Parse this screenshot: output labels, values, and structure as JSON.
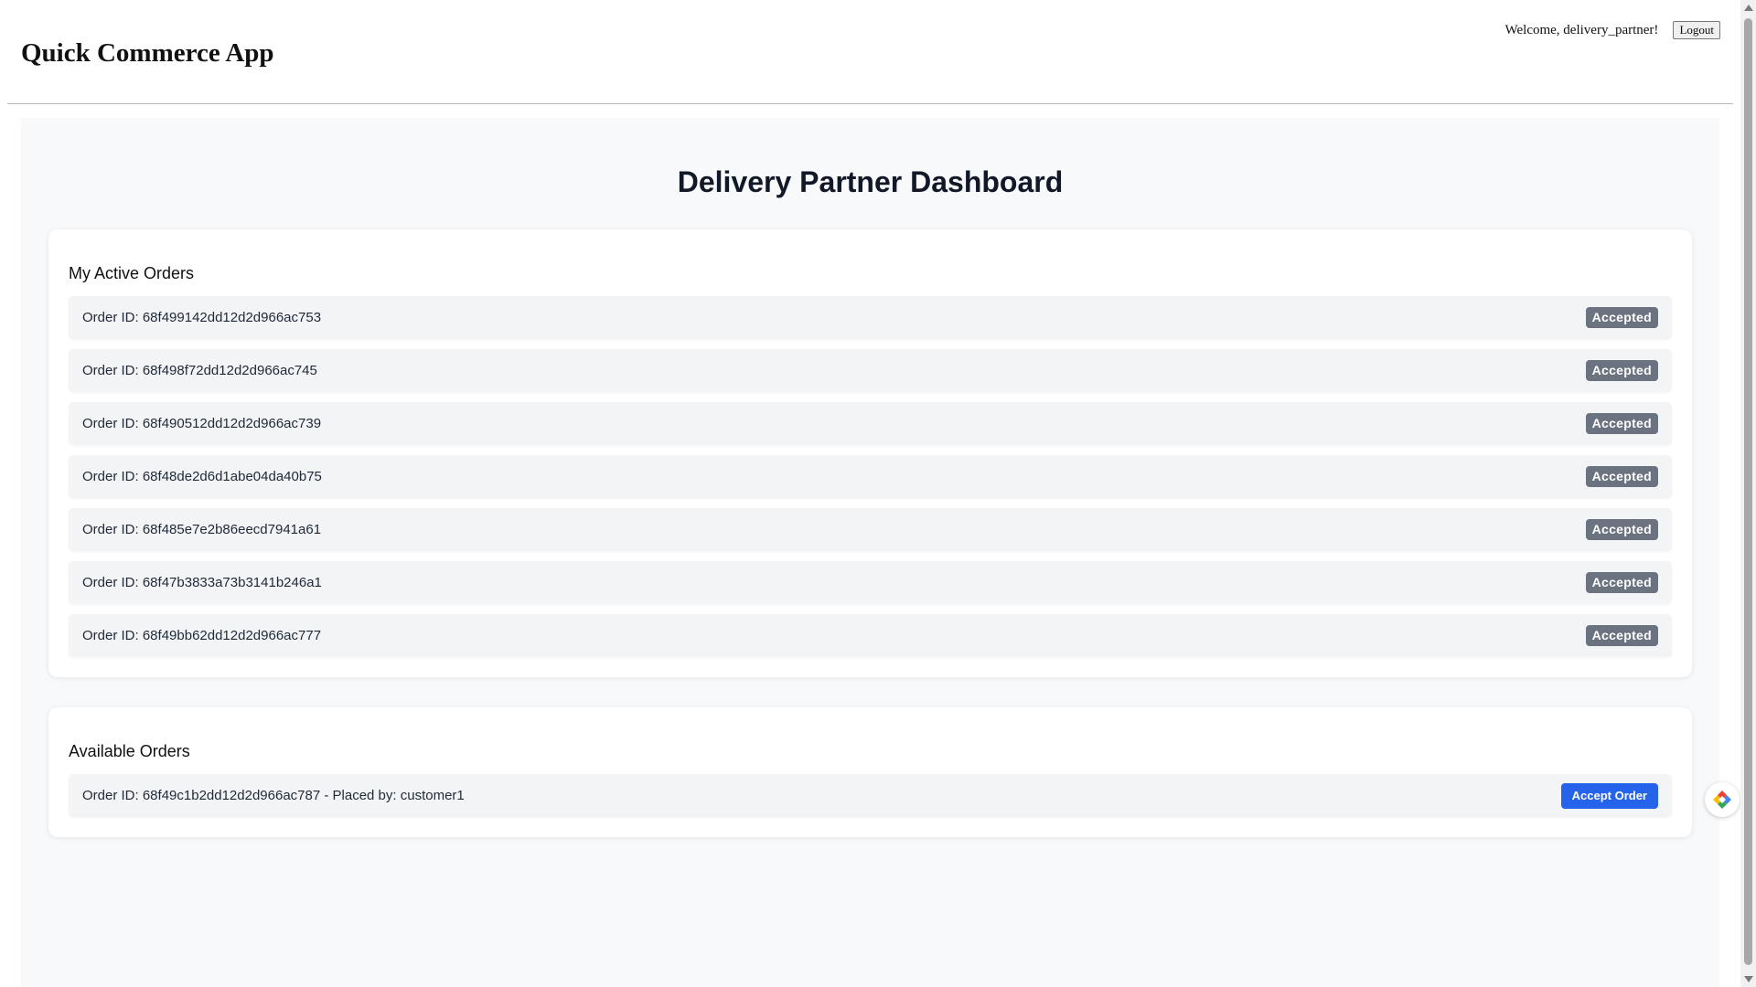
{
  "header": {
    "app_title": "Quick Commerce App",
    "welcome_text": "Welcome, delivery_partner!",
    "logout_label": "Logout"
  },
  "dashboard": {
    "title": "Delivery Partner Dashboard"
  },
  "active_orders": {
    "title": "My Active Orders",
    "items": [
      {
        "text": "Order ID: 68f499142dd12d2d966ac753",
        "status": "Accepted"
      },
      {
        "text": "Order ID: 68f498f72dd12d2d966ac745",
        "status": "Accepted"
      },
      {
        "text": "Order ID: 68f490512dd12d2d966ac739",
        "status": "Accepted"
      },
      {
        "text": "Order ID: 68f48de2d6d1abe04da40b75",
        "status": "Accepted"
      },
      {
        "text": "Order ID: 68f485e7e2b86eecd7941a61",
        "status": "Accepted"
      },
      {
        "text": "Order ID: 68f47b3833a73b3141b246a1",
        "status": "Accepted"
      },
      {
        "text": "Order ID: 68f49bb62dd12d2d966ac777",
        "status": "Accepted"
      }
    ]
  },
  "available_orders": {
    "title": "Available Orders",
    "items": [
      {
        "text": "Order ID: 68f49c1b2dd12d2d966ac787 - Placed by: customer1",
        "action_label": "Accept Order"
      }
    ]
  },
  "colors": {
    "accent_button": "#2563eb",
    "status_badge": "#6b7280",
    "page_background": "#f8f9fb",
    "row_background": "#f3f4f6"
  },
  "icons": {
    "floating_widget": "colorful-diamond-logo-icon",
    "scroll_up": "triangle-up-icon",
    "scroll_down": "triangle-down-icon"
  }
}
